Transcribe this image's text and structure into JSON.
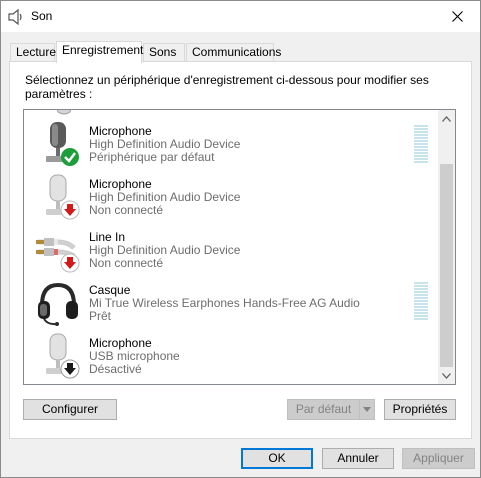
{
  "window": {
    "title": "Son",
    "close_glyph": "✕"
  },
  "tabs": [
    {
      "label": "Lecture",
      "active": false
    },
    {
      "label": "Enregistrement",
      "active": true
    },
    {
      "label": "Sons",
      "active": false
    },
    {
      "label": "Communications",
      "active": false
    }
  ],
  "instruction": "Sélectionnez un périphérique d'enregistrement ci-dessous pour modifier ses paramètres :",
  "devices": [
    {
      "name": "Microphone",
      "driver": "High Definition Audio Device",
      "status": "Périphérique par défaut",
      "icon": "microphone-icon",
      "badge": "default-check-icon",
      "meter": true
    },
    {
      "name": "Microphone",
      "driver": "High Definition Audio Device",
      "status": "Non connecté",
      "icon": "microphone-icon",
      "badge": "unplugged-arrow-icon",
      "meter": false
    },
    {
      "name": "Line In",
      "driver": "High Definition Audio Device",
      "status": "Non connecté",
      "icon": "line-in-cable-icon",
      "badge": "unplugged-arrow-icon",
      "meter": false
    },
    {
      "name": "Casque",
      "driver": "Mi True Wireless Earphones Hands-Free AG Audio",
      "status": "Prêt",
      "icon": "headset-icon",
      "badge": "",
      "meter": true
    },
    {
      "name": "Microphone",
      "driver": "USB microphone",
      "status": "Désactivé",
      "icon": "microphone-icon",
      "badge": "disabled-arrow-icon",
      "meter": false
    }
  ],
  "buttons": {
    "configure": "Configurer",
    "set_default": "Par défaut",
    "properties": "Propriétés",
    "ok": "OK",
    "cancel": "Annuler",
    "apply": "Appliquer"
  },
  "colors": {
    "check_badge": "#1e9e3a",
    "unplugged_badge": "#d31a1a",
    "meter_idle": "#c9e3ec",
    "focus_border": "#0078d7",
    "secondary_text": "#6d6d6d"
  }
}
